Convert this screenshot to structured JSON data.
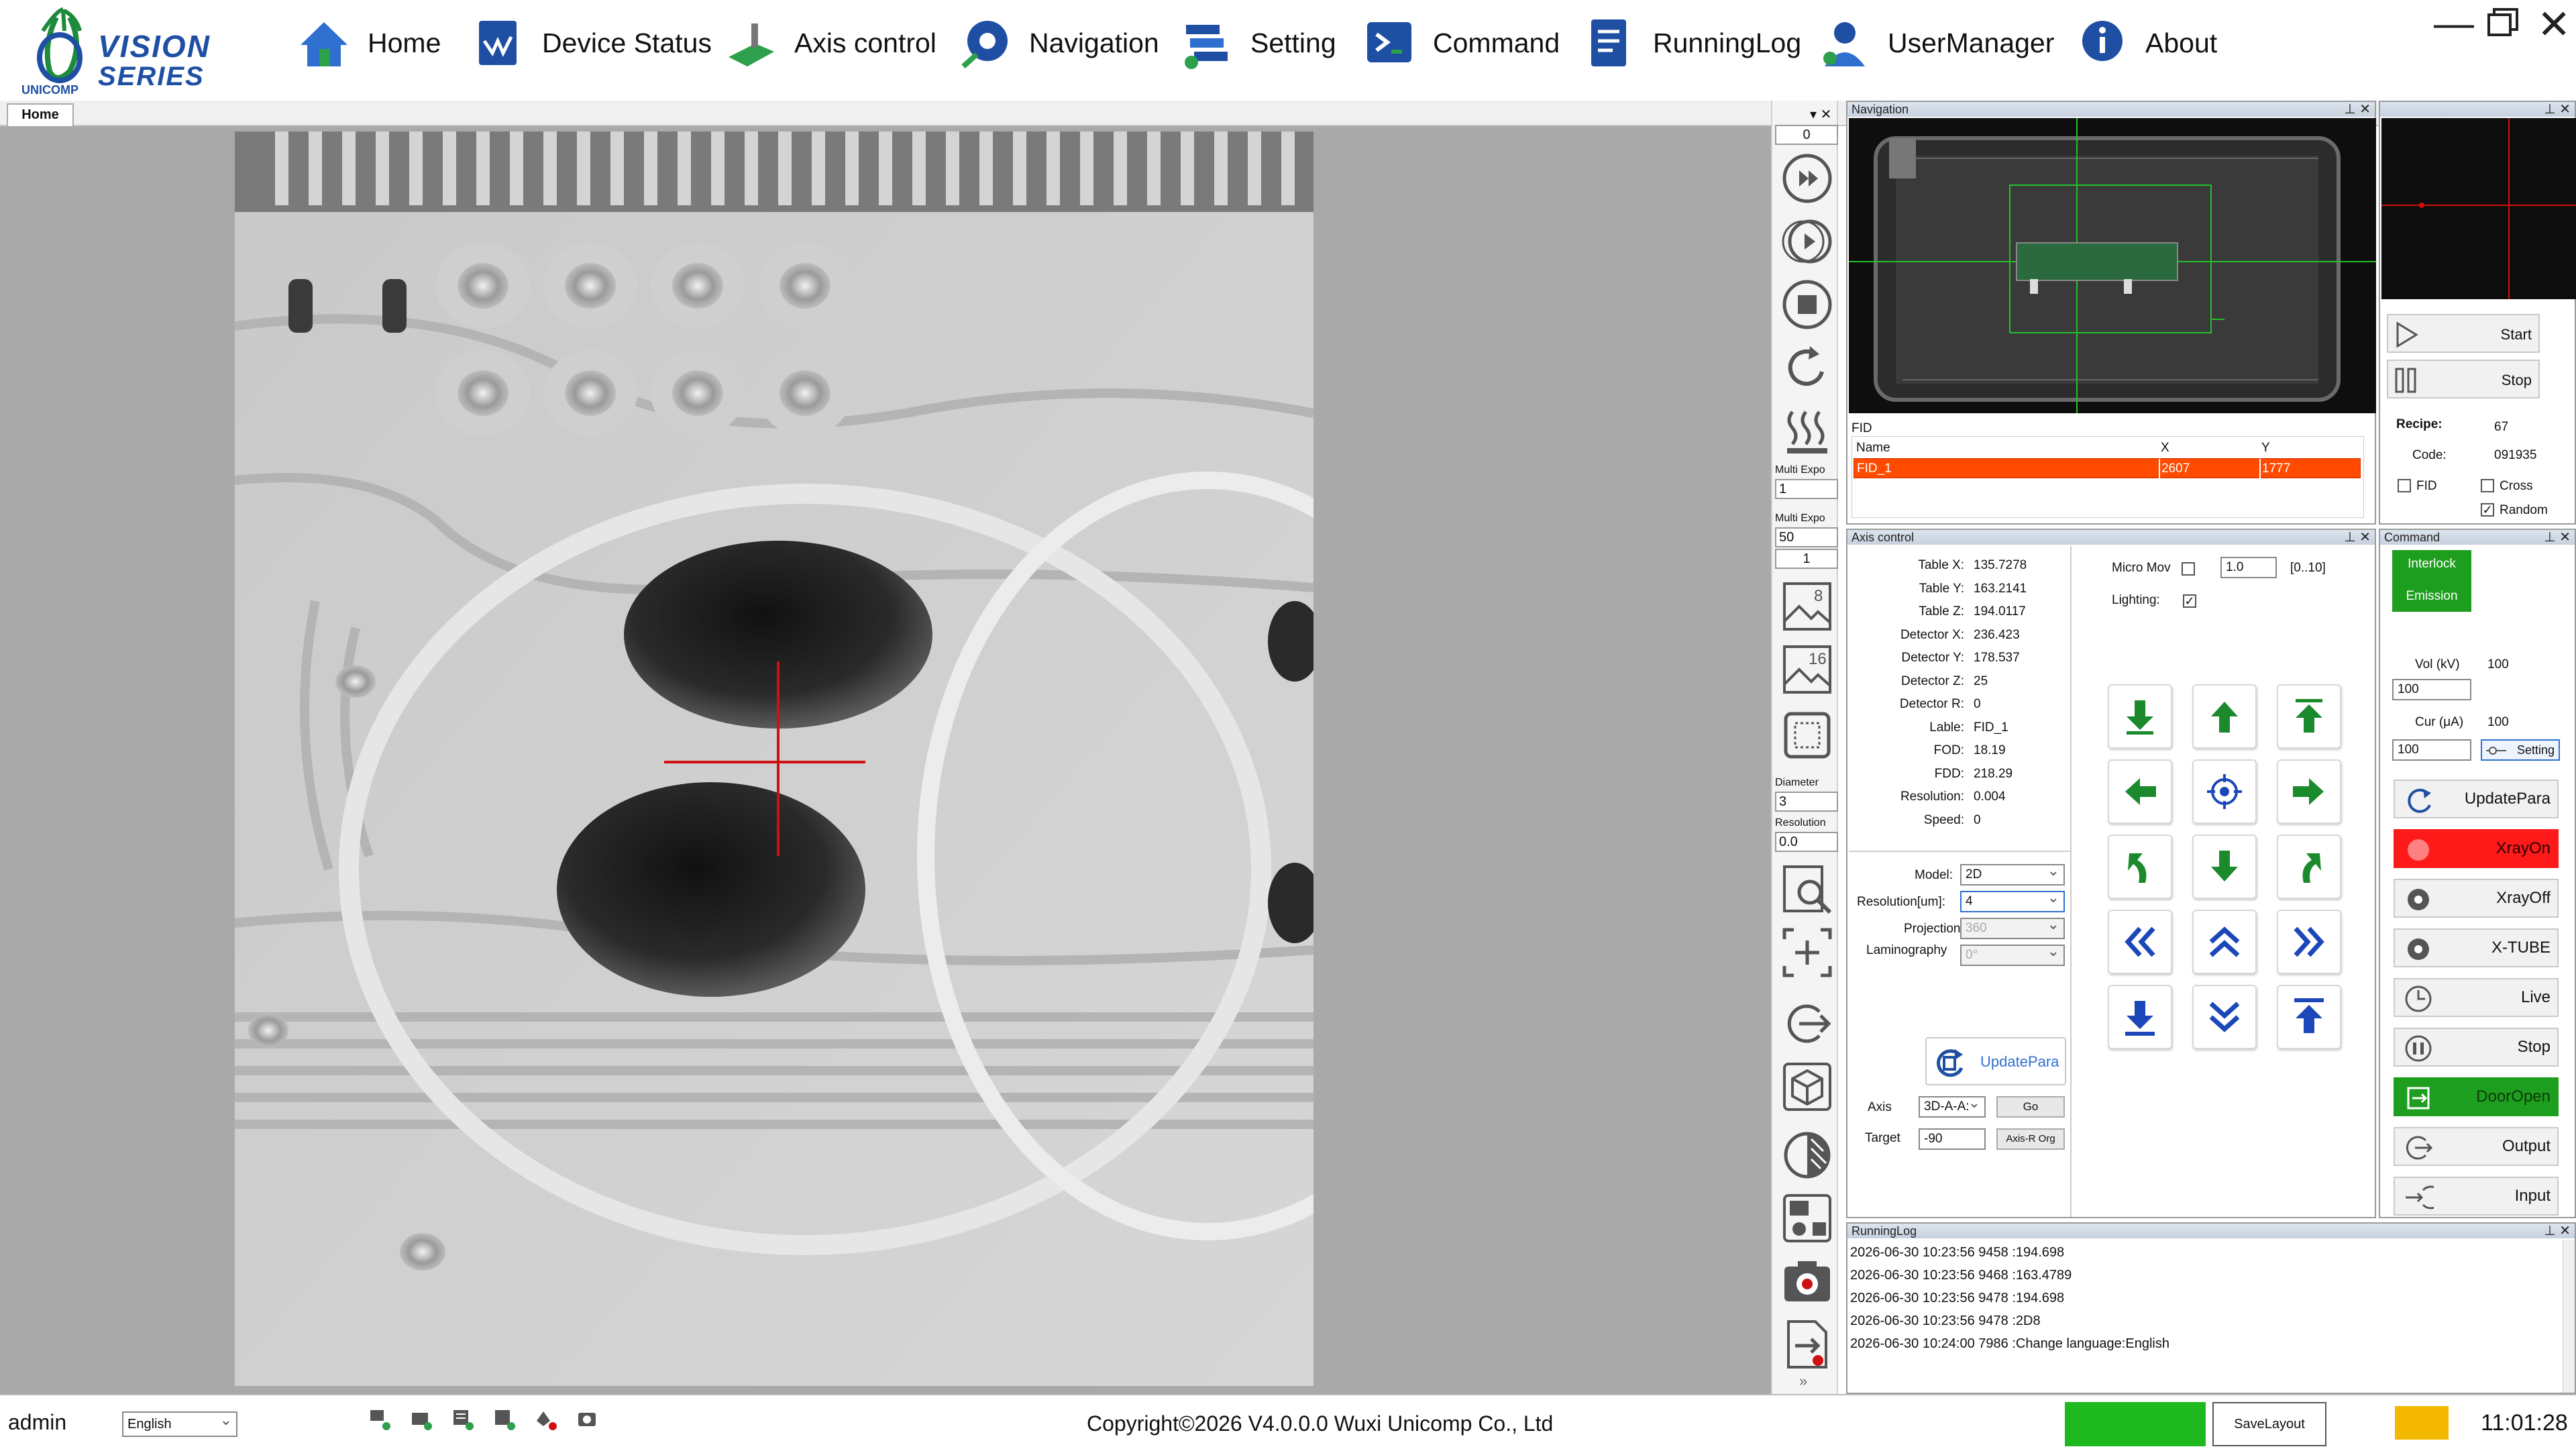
{
  "brand": {
    "name_line1": "VISION",
    "name_line2": "SERIES",
    "company": "UNICOMP"
  },
  "menu": [
    {
      "label": "Home",
      "icon": "home-icon"
    },
    {
      "label": "Device Status",
      "icon": "device-status-icon"
    },
    {
      "label": "Axis control",
      "icon": "axis-control-icon"
    },
    {
      "label": "Navigation",
      "icon": "navigation-icon"
    },
    {
      "label": "Setting",
      "icon": "setting-icon"
    },
    {
      "label": "Command",
      "icon": "command-icon"
    },
    {
      "label": "RunningLog",
      "icon": "running-log-icon"
    },
    {
      "label": "UserManager",
      "icon": "user-manager-icon"
    },
    {
      "label": "About",
      "icon": "about-icon"
    }
  ],
  "doc_tab": {
    "label": "Home"
  },
  "toolstrip": {
    "frame_value": "0",
    "multi_expo_label_1": "Multi Expo",
    "multi_expo_value_1": "1",
    "multi_expo_label_2": "Multi Expo",
    "multi_expo_value_2": "50",
    "multi_expo_value_3": "1",
    "diameter_label": "Diameter",
    "diameter_value": "3",
    "resolution_label": "Resolution",
    "resolution_value": "0.0",
    "more": "»"
  },
  "navigation": {
    "title": "Navigation",
    "fid_section": "FID",
    "columns": [
      "Name",
      "X",
      "Y"
    ],
    "rows": [
      {
        "name": "FID_1",
        "x": "2607",
        "y": "1777"
      }
    ],
    "start_label": "Start",
    "stop_label": "Stop",
    "recipe_label": "Recipe:",
    "recipe_value": "67",
    "code_label": "Code:",
    "code_value": "091935",
    "fid_check": "FID",
    "cross_check": "Cross",
    "random_check": "Random",
    "random_checked": true
  },
  "axis": {
    "title": "Axis control",
    "values": [
      {
        "label": "Table X:",
        "value": "135.7278"
      },
      {
        "label": "Table Y:",
        "value": "163.2141"
      },
      {
        "label": "Table Z:",
        "value": "194.0117"
      },
      {
        "label": "Detector X:",
        "value": "236.423"
      },
      {
        "label": "Detector Y:",
        "value": "178.537"
      },
      {
        "label": "Detector Z:",
        "value": "25"
      },
      {
        "label": "Detector R:",
        "value": "0"
      },
      {
        "label": "Lable:",
        "value": "FID_1"
      },
      {
        "label": "FOD:",
        "value": "18.19"
      },
      {
        "label": "FDD:",
        "value": "218.29"
      },
      {
        "label": "Resolution:",
        "value": "0.004"
      },
      {
        "label": "Speed:",
        "value": "0"
      }
    ],
    "micro_move_label": "Micro Mov",
    "micro_move_value": "1.0",
    "micro_range": "[0..10]",
    "lighting_label": "Lighting:",
    "lighting_checked": true,
    "model_label": "Model:",
    "model_value": "2D",
    "resolution_um_label": "Resolution[um]:",
    "resolution_um_value": "4",
    "projection_label": "Projection:",
    "projection_value": "360",
    "laminography_label": "Laminography",
    "laminography_value": "0°",
    "update_para": "UpdatePara",
    "axis_label": "Axis",
    "axis_value": "3D-A-A:",
    "go_label": "Go",
    "target_label": "Target",
    "target_value": "-90",
    "axis_r_org": "Axis-R Org"
  },
  "command": {
    "title": "Command",
    "interlock": "Interlock",
    "emission": "Emission",
    "vol_label": "Vol (kV)",
    "vol_value": "100",
    "vol_input": "100",
    "cur_label": "Cur (μA)",
    "cur_value": "100",
    "cur_input": "100",
    "setting": "Setting",
    "buttons": [
      {
        "label": "UpdatePara",
        "icon": "update-para-icon"
      },
      {
        "label": "XrayOn",
        "icon": "xray-on-icon",
        "bg": "#ff1a1a"
      },
      {
        "label": "XrayOff",
        "icon": "xray-off-icon"
      },
      {
        "label": "X-TUBE",
        "icon": "xtube-icon"
      },
      {
        "label": "Live",
        "icon": "live-clock-icon"
      },
      {
        "label": "Stop",
        "icon": "pause-icon"
      },
      {
        "label": "DoorOpen",
        "icon": "door-open-icon",
        "bg": "#1e9e1e"
      },
      {
        "label": "Output",
        "icon": "output-icon"
      },
      {
        "label": "Input",
        "icon": "input-icon"
      }
    ]
  },
  "runninglog": {
    "title": "RunningLog",
    "lines": [
      "2026-06-30 10:23:56 9458 :194.698",
      "2026-06-30 10:23:56 9468 :163.4789",
      "2026-06-30 10:23:56 9478 :194.698",
      "2026-06-30 10:23:56 9478 :2D8",
      "2026-06-30 10:24:00 7986 :Change language:English"
    ]
  },
  "statusbar": {
    "user": "admin",
    "language": "English",
    "copyright": "Copyright©2026 V4.0.0.0 Wuxi Unicomp Co., Ltd",
    "save_layout": "SaveLayout",
    "time": "11:01:28",
    "status_color": "#1eb91e",
    "warn_color": "#f5b800"
  },
  "colors": {
    "accent_green": "#1e9e1e",
    "xray_red": "#ff1a1a",
    "fid_row": "#ff4a00",
    "arrow_green": "#1b8a2c",
    "arrow_blue": "#1c47b8"
  }
}
